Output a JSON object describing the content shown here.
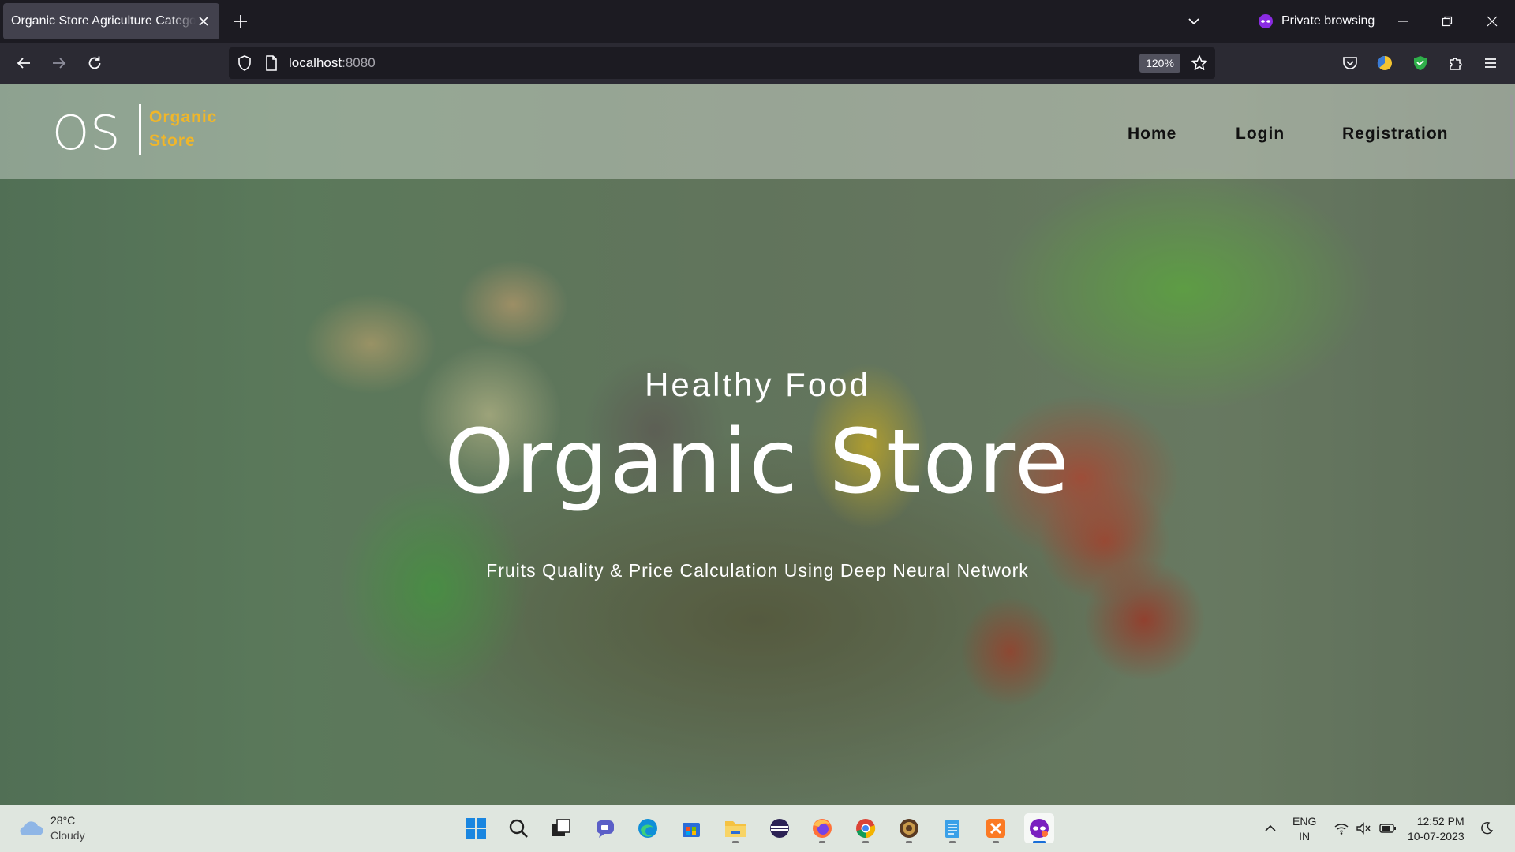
{
  "browser": {
    "tab_title": "Organic Store Agriculture Category",
    "private_label": "Private browsing",
    "url_host": "localhost",
    "url_port": ":8080",
    "zoom": "120%"
  },
  "site": {
    "logo_initials": "OS",
    "logo_name_line1": "Organic",
    "logo_name_line2": "Store",
    "nav": [
      "Home",
      "Login",
      "Registration"
    ],
    "hero_subtitle": "Healthy Food",
    "hero_title": "Organic Store",
    "hero_description": "Fruits Quality & Price Calculation Using Deep Neural Network",
    "accent_color": "#f0b62a"
  },
  "taskbar": {
    "weather_temp": "28°C",
    "weather_condition": "Cloudy",
    "apps": [
      "start-icon",
      "search-icon",
      "task-view-icon",
      "teams-chat-icon",
      "edge-icon",
      "store-icon",
      "file-explorer-icon",
      "eclipse-icon",
      "firefox-icon",
      "chrome-icon",
      "app-icon",
      "notepad-icon",
      "xampp-icon",
      "firefox-private-icon"
    ],
    "lang_line1": "ENG",
    "lang_line2": "IN",
    "time": "12:52 PM",
    "date": "10-07-2023"
  }
}
